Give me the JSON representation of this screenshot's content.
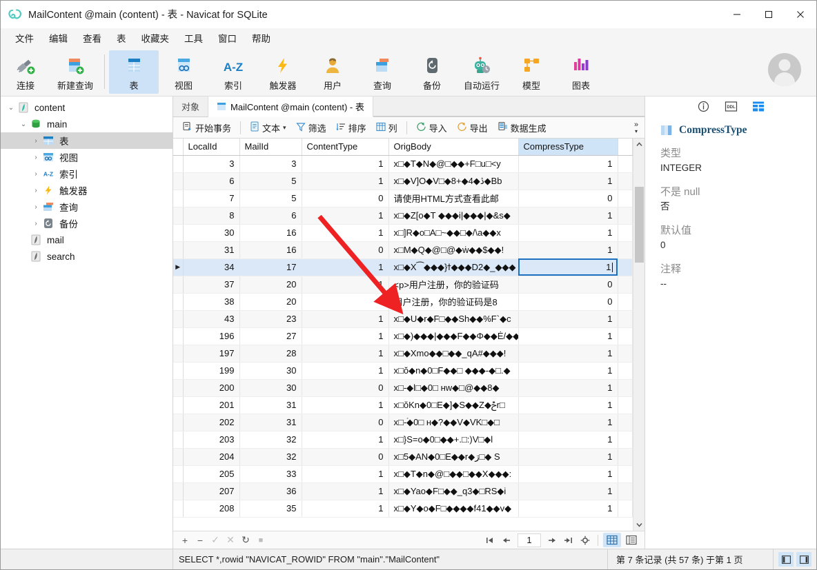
{
  "window": {
    "title": "MailContent @main (content) - 表 - Navicat for SQLite",
    "minimize": "–",
    "maximize": "□",
    "close": "✕"
  },
  "menubar": {
    "items": [
      "文件",
      "编辑",
      "查看",
      "表",
      "收藏夹",
      "工具",
      "窗口",
      "帮助"
    ]
  },
  "toolbar": {
    "groups": [
      [
        {
          "label": "连接",
          "icon": "connection-icon"
        },
        {
          "label": "新建查询",
          "icon": "new-query-icon"
        }
      ],
      [
        {
          "label": "表",
          "icon": "table-icon",
          "active": true
        },
        {
          "label": "视图",
          "icon": "view-icon"
        },
        {
          "label": "索引",
          "icon": "index-az-icon"
        },
        {
          "label": "触发器",
          "icon": "trigger-bolt-icon"
        },
        {
          "label": "用户",
          "icon": "user-icon"
        },
        {
          "label": "查询",
          "icon": "query-icon"
        },
        {
          "label": "备份",
          "icon": "backup-icon"
        },
        {
          "label": "自动运行",
          "icon": "automation-robot-icon"
        },
        {
          "label": "模型",
          "icon": "model-icon"
        },
        {
          "label": "图表",
          "icon": "chart-icon"
        }
      ]
    ]
  },
  "sidebar": {
    "items": [
      {
        "label": "content",
        "level": 0,
        "icon": "sqlite-db-icon",
        "expanded": true,
        "chevron": "⌄",
        "selected": false
      },
      {
        "label": "main",
        "level": 1,
        "icon": "schema-icon",
        "expanded": true,
        "chevron": "⌄",
        "selected": false
      },
      {
        "label": "表",
        "level": 2,
        "icon": "table-icon",
        "expanded": false,
        "chevron": "›",
        "selected": true
      },
      {
        "label": "视图",
        "level": 2,
        "icon": "view-icon",
        "expanded": false,
        "chevron": "›",
        "selected": false
      },
      {
        "label": "索引",
        "level": 2,
        "icon": "index-az-icon",
        "expanded": false,
        "chevron": "›",
        "selected": false
      },
      {
        "label": "触发器",
        "level": 2,
        "icon": "trigger-bolt-icon",
        "expanded": false,
        "chevron": "›",
        "selected": false
      },
      {
        "label": "查询",
        "level": 2,
        "icon": "query-icon",
        "expanded": false,
        "chevron": "›",
        "selected": false
      },
      {
        "label": "备份",
        "level": 2,
        "icon": "backup-icon",
        "expanded": false,
        "chevron": "›",
        "selected": false
      },
      {
        "label": "mail",
        "level": 0,
        "icon": "sqlite-db-icon",
        "expanded": false,
        "chevron": "",
        "selected": false
      },
      {
        "label": "search",
        "level": 0,
        "icon": "sqlite-db-icon",
        "expanded": false,
        "chevron": "",
        "selected": false
      }
    ]
  },
  "tabs": {
    "object_tab": "对象",
    "active_tab": "MailContent @main (content) - 表"
  },
  "gridbar": {
    "begin_transaction": "开始事务",
    "text": "文本",
    "text_caret": "▾",
    "filter": "筛选",
    "sort": "排序",
    "columns": "列",
    "import": "导入",
    "export": "导出",
    "data_generation": "数据生成",
    "overflow": "»"
  },
  "grid": {
    "columns": [
      "LocalId",
      "MailId",
      "ContentType",
      "OrigBody",
      "CompressType"
    ],
    "selected_column": "CompressType",
    "rows": [
      {
        "LocalId": "3",
        "MailId": "3",
        "ContentType": "1",
        "OrigBody": "x□◆T◆N◆@□◆◆+F□u□<y",
        "CompressType": "1"
      },
      {
        "LocalId": "6",
        "MailId": "5",
        "ContentType": "1",
        "OrigBody": "x□◆V]O◆V□◆8+◆4◆ڎ◆Bb",
        "CompressType": "1"
      },
      {
        "LocalId": "7",
        "MailId": "5",
        "ContentType": "0",
        "OrigBody": "请使用HTML方式查看此邮",
        "CompressType": "0"
      },
      {
        "LocalId": "8",
        "MailId": "6",
        "ContentType": "1",
        "OrigBody": "x□◆Z[o◆T ◆◆◆i|◆◆◆|◆&s◆",
        "CompressType": "1"
      },
      {
        "LocalId": "30",
        "MailId": "16",
        "ContentType": "1",
        "OrigBody": "x□]R◆o□A□~◆◆□◆/\\a◆◆x",
        "CompressType": "1"
      },
      {
        "LocalId": "31",
        "MailId": "16",
        "ContentType": "0",
        "OrigBody": "x□M◆Q◆@□@◆ẇ◆◆$◆◆!",
        "CompressType": "1"
      },
      {
        "LocalId": "34",
        "MailId": "17",
        "ContentType": "1",
        "OrigBody": "x□◆X⁀◆◆◆}ϯ◆◆◆D2◆_◆◆◆",
        "CompressType": "1",
        "current": true,
        "editing": true
      },
      {
        "LocalId": "37",
        "MailId": "20",
        "ContentType": "1",
        "OrigBody": "<p>用户注册，你的验证码",
        "CompressType": "0"
      },
      {
        "LocalId": "38",
        "MailId": "20",
        "ContentType": "0",
        "OrigBody": "用户注册，你的验证码是8",
        "CompressType": "0"
      },
      {
        "LocalId": "43",
        "MailId": "23",
        "ContentType": "1",
        "OrigBody": "x□◆U◆r◆F□◆◆Sh◆◆%F`◆c",
        "CompressType": "1"
      },
      {
        "LocalId": "196",
        "MailId": "27",
        "ContentType": "1",
        "OrigBody": "x□◆)◆◆◆|◆◆◆F◆◆Φ◆◆Ė/◆◆",
        "CompressType": "1"
      },
      {
        "LocalId": "197",
        "MailId": "28",
        "ContentType": "1",
        "OrigBody": "x□◆Xmo◆◆□◆◆_qA#◆◆◆!",
        "CompressType": "1"
      },
      {
        "LocalId": "199",
        "MailId": "30",
        "ContentType": "1",
        "OrigBody": "x□ŏ◆n◆0□F◆◆□ ◆◆◆-◆□.◆",
        "CompressType": "1"
      },
      {
        "LocalId": "200",
        "MailId": "30",
        "ContentType": "0",
        "OrigBody": "x□-◆l□◆0□ нw◆□@◆◆8◆",
        "CompressType": "1"
      },
      {
        "LocalId": "201",
        "MailId": "31",
        "ContentType": "1",
        "OrigBody": "x□ŏKn◆0□E◆]◆S◆◆Z◆ݲr□",
        "CompressType": "1"
      },
      {
        "LocalId": "202",
        "MailId": "31",
        "ContentType": "0",
        "OrigBody": "x□-ۘ◆0□ н◆?◆◆V◆VK□◆□",
        "CompressType": "1"
      },
      {
        "LocalId": "203",
        "MailId": "32",
        "ContentType": "1",
        "OrigBody": "x□}S=o◆0□◆◆+.□:)V□◆l",
        "CompressType": "1"
      },
      {
        "LocalId": "204",
        "MailId": "32",
        "ContentType": "0",
        "OrigBody": "x□5◆AN◆0□E◆◆r◆ڗ□◆ S",
        "CompressType": "1"
      },
      {
        "LocalId": "205",
        "MailId": "33",
        "ContentType": "1",
        "OrigBody": "x□◆T◆n◆@□◆◆□◆◆X◆◆◆:",
        "CompressType": "1"
      },
      {
        "LocalId": "207",
        "MailId": "36",
        "ContentType": "1",
        "OrigBody": "x□◆Yao◆F□◆◆_q3◆□RS◆i",
        "CompressType": "1"
      },
      {
        "LocalId": "208",
        "MailId": "35",
        "ContentType": "1",
        "OrigBody": "x□◆Y◆o◆F□◆◆◆◆f41◆◆v◆",
        "CompressType": "1"
      }
    ]
  },
  "navbar": {
    "add": "+",
    "remove": "−",
    "apply": "✓",
    "cancel": "✕",
    "refresh": "↻",
    "stop": "■",
    "first_page": "|←",
    "prev_page": "←",
    "page_value": "1",
    "next_page": "→",
    "last_page": "→|",
    "settings": "✿",
    "grid_view": "grid-view-icon",
    "form_view": "form-view-icon"
  },
  "rightpanel": {
    "tabs": [
      {
        "icon": "info-icon",
        "active": false
      },
      {
        "icon": "ddl-icon",
        "active": false
      },
      {
        "icon": "table-columns-icon",
        "active": true
      }
    ],
    "field_name": "CompressType",
    "fields": [
      {
        "label": "类型",
        "value": "INTEGER"
      },
      {
        "label": "不是 null",
        "value": "否"
      },
      {
        "label": "默认值",
        "value": "0"
      },
      {
        "label": "注释",
        "value": "--"
      }
    ]
  },
  "statusbar": {
    "sql": "SELECT *,rowid \"NAVICAT_ROWID\" FROM \"main\".\"MailContent\"",
    "record_info": "第 7 条记录  (共 57 条)  于第 1 页"
  },
  "colors": {
    "accent_blue": "#1d6fc0",
    "selection_blue": "#cfe4f7",
    "current_row": "#dbe8f7",
    "arrow_red": "#ee2222",
    "title_teal": "#4ec9c0"
  }
}
